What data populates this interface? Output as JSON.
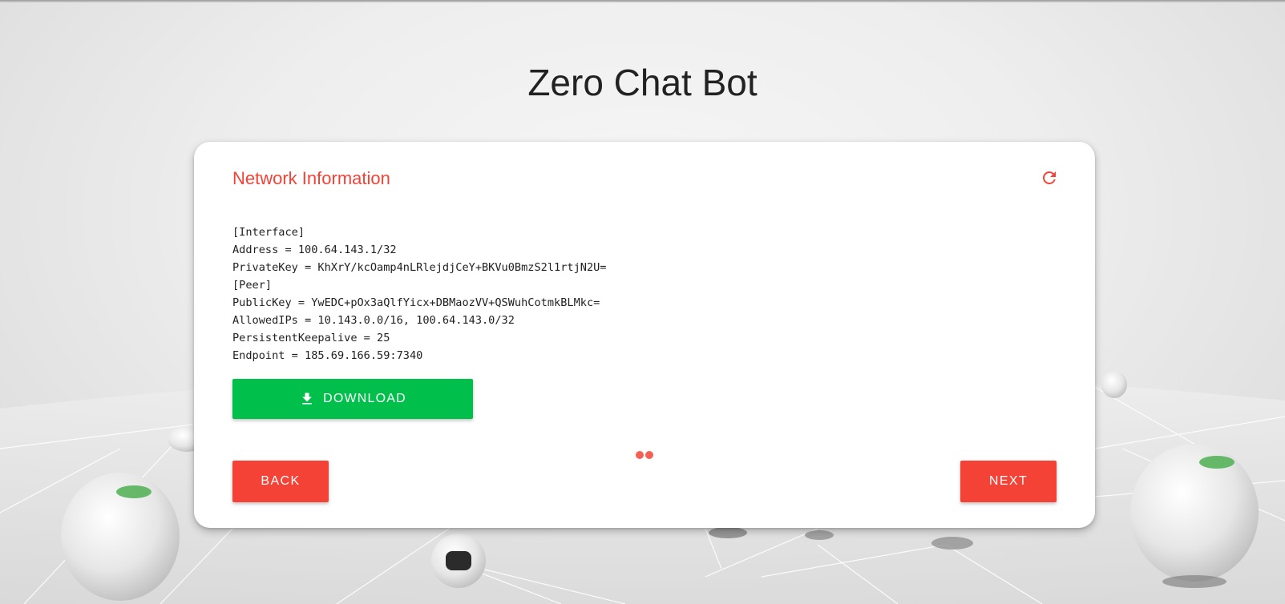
{
  "page": {
    "title": "Zero Chat Bot"
  },
  "card": {
    "title": "Network Information",
    "refresh_icon": "refresh-icon",
    "config_lines": [
      "[Interface]",
      "Address = 100.64.143.1/32",
      "PrivateKey = KhXrY/kcOamp4nLRlejdjCeY+BKVu0BmzS2l1rtjN2U=",
      "[Peer]",
      "PublicKey = YwEDC+pOx3aQlfYicx+DBMaozVV+QSWuhCotmkBLMkc=",
      "AllowedIPs = 10.143.0.0/16, 100.64.143.0/32",
      "PersistentKeepalive = 25",
      "Endpoint = 185.69.166.59:7340"
    ],
    "download": {
      "label": "DOWNLOAD",
      "icon": "download-icon"
    }
  },
  "nav": {
    "back_label": "BACK",
    "next_label": "NEXT"
  },
  "colors": {
    "accent": "#f44336",
    "success": "#00c04b",
    "text": "#222222"
  }
}
